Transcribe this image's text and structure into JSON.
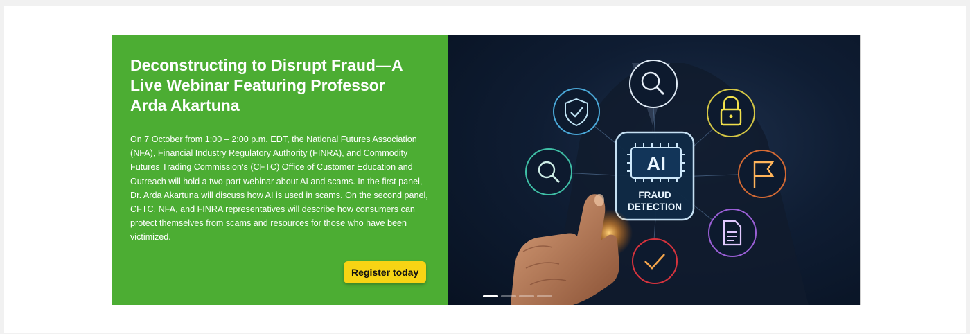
{
  "banner": {
    "title": "Deconstructing to Disrupt Fraud—A Live Webinar Featuring Professor Arda Akartuna",
    "description": "On 7 October from 1:00 – 2:00 p.m. EDT, the National Futures Association (NFA), Financial Industry Regulatory Authority (FINRA), and Commodity Futures Trading Commission’s (CFTC) Office of Customer Education and Outreach will hold a two-part webinar about AI and scams. In the first panel, Dr. Arda Akartuna will discuss how AI is used in scams. On the second panel, CFTC, NFA, and FINRA representatives will describe how consumers can protect themselves from scams and resources for those who have been victimized.",
    "cta_label": "Register today",
    "panel_color": "#4cad33",
    "cta_color": "#f7d414"
  },
  "hero": {
    "chip_text": "AI",
    "caption_line1": "FRAUD",
    "caption_line2": "DETECTION",
    "icons": [
      "magnifier-icon",
      "padlock-icon",
      "flag-icon",
      "document-icon",
      "checkmark-icon",
      "search-icon",
      "shield-check-icon"
    ]
  },
  "carousel": {
    "slides": 4,
    "active_index": 0
  }
}
